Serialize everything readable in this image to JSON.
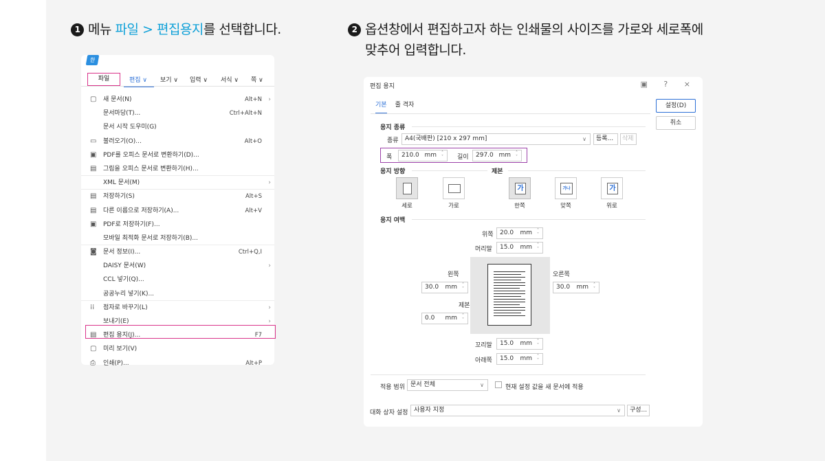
{
  "steps": {
    "step1": {
      "num": "1",
      "prefix": "메뉴 ",
      "highlight": "파일 > 편집용지",
      "suffix": "를 선택합니다."
    },
    "step2": {
      "num": "2",
      "line1": "옵션창에서 편집하고자 하는 인쇄물의 사이즈를 가로와 세로폭에",
      "line2": "맞추어 입력합니다."
    }
  },
  "menu": {
    "logo": "한",
    "bar": {
      "file": "파일",
      "edit": "편집 ∨",
      "view": "보기 ∨",
      "input": "입력 ∨",
      "format": "서식 ∨",
      "page": "쪽 ∨"
    },
    "items": [
      {
        "icon": "new-doc-icon",
        "glyph": "▢",
        "label": "새 문서(N)",
        "shortcut": "Alt+N",
        "arrow": "›",
        "sep": false
      },
      {
        "icon": "",
        "glyph": "",
        "label": "문서마당(T)...",
        "shortcut": "Ctrl+Alt+N",
        "arrow": "",
        "sep": false
      },
      {
        "icon": "",
        "glyph": "",
        "label": "문서 시작 도우미(G)",
        "shortcut": "",
        "arrow": "",
        "sep": false
      },
      {
        "icon": "folder-icon",
        "glyph": "▭",
        "label": "불러오기(O)...",
        "shortcut": "Alt+O",
        "arrow": "",
        "sep": false
      },
      {
        "icon": "pdf-icon",
        "glyph": "▣",
        "label": "PDF를 오피스 문서로 변환하기(D)...",
        "shortcut": "",
        "arrow": "",
        "sep": false
      },
      {
        "icon": "image-convert-icon",
        "glyph": "▤",
        "label": "그림을 오피스 문서로 변환하기(H)...",
        "shortcut": "",
        "arrow": "",
        "sep": true
      },
      {
        "icon": "",
        "glyph": "",
        "label": "XML 문서(M)",
        "shortcut": "",
        "arrow": "›",
        "sep": true
      },
      {
        "icon": "save-icon",
        "glyph": "▤",
        "label": "저장하기(S)",
        "shortcut": "Alt+S",
        "arrow": "",
        "sep": false
      },
      {
        "icon": "save-as-icon",
        "glyph": "▤",
        "label": "다른 이름으로 저장하기(A)...",
        "shortcut": "Alt+V",
        "arrow": "",
        "sep": false
      },
      {
        "icon": "save-pdf-icon",
        "glyph": "▣",
        "label": "PDF로 저장하기(F)...",
        "shortcut": "",
        "arrow": "",
        "sep": false
      },
      {
        "icon": "",
        "glyph": "",
        "label": "모바일 최적화 문서로 저장하기(B)...",
        "shortcut": "",
        "arrow": "",
        "sep": true
      },
      {
        "icon": "doc-info-icon",
        "glyph": "◙",
        "label": "문서 정보(I)...",
        "shortcut": "Ctrl+Q,I",
        "arrow": "",
        "sep": false
      },
      {
        "icon": "",
        "glyph": "",
        "label": "DAISY 문서(W)",
        "shortcut": "",
        "arrow": "›",
        "sep": false
      },
      {
        "icon": "",
        "glyph": "",
        "label": "CCL 넣기(Q)...",
        "shortcut": "",
        "arrow": "",
        "sep": false
      },
      {
        "icon": "",
        "glyph": "",
        "label": "공공누리 넣기(K)...",
        "shortcut": "",
        "arrow": "",
        "sep": true
      },
      {
        "icon": "braille-icon",
        "glyph": "⁞⁞",
        "label": "점자로 바꾸기(L)",
        "shortcut": "",
        "arrow": "›",
        "sep": false
      },
      {
        "icon": "",
        "glyph": "",
        "label": "보내기(E)",
        "shortcut": "",
        "arrow": "›",
        "sep": false
      },
      {
        "icon": "page-setup-icon",
        "glyph": "▤",
        "label": "편집 용지(J)...",
        "shortcut": "F7",
        "arrow": "",
        "sep": false
      },
      {
        "icon": "preview-icon",
        "glyph": "▢",
        "label": "미리 보기(V)",
        "shortcut": "",
        "arrow": "",
        "sep": false
      },
      {
        "icon": "print-icon",
        "glyph": "⎙",
        "label": "인쇄(P)...",
        "shortcut": "Alt+P",
        "arrow": "",
        "sep": false
      }
    ]
  },
  "dialog": {
    "title": "편집 용지",
    "controls": "▣ ? ×",
    "tabs": {
      "basic": "기본",
      "binding": "줄 격자"
    },
    "ok": "설정(D)",
    "cancel": "취소",
    "paper_type": {
      "section": "용지 종류",
      "kind_label": "종류",
      "kind_value": "A4(국배판) [210 x 297 mm]",
      "register": "등록...",
      "delete": "삭제",
      "width_label": "폭",
      "width_value": "210.0",
      "height_label": "길이",
      "height_value": "297.0",
      "unit": "mm"
    },
    "orientation": {
      "section": "용지 방향",
      "portrait": "세로",
      "landscape": "가로"
    },
    "binding": {
      "section": "제본",
      "single": "한쪽",
      "facing": "맞쪽",
      "top": "위로",
      "ga": "가",
      "ga_facing": "가나"
    },
    "margins": {
      "section": "용지 여백",
      "top_label": "위쪽",
      "top_value": "20.0",
      "header_label": "머리말",
      "header_value": "15.0",
      "left_label": "왼쪽",
      "left_value": "30.0",
      "right_label": "오른쪽",
      "right_value": "30.0",
      "gutter_label": "제본",
      "gutter_value": "0.0",
      "footer_label": "꼬리말",
      "footer_value": "15.0",
      "bottom_label": "아래쪽",
      "bottom_value": "15.0",
      "unit": "mm"
    },
    "apply": {
      "label": "적용 범위",
      "value": "문서 전체",
      "check_label": "현재 설정 값을 새 문서에 적용"
    },
    "dialog_settings": {
      "label": "대화 상자 설정",
      "value": "사용자 지정",
      "configure": "구성..."
    }
  }
}
